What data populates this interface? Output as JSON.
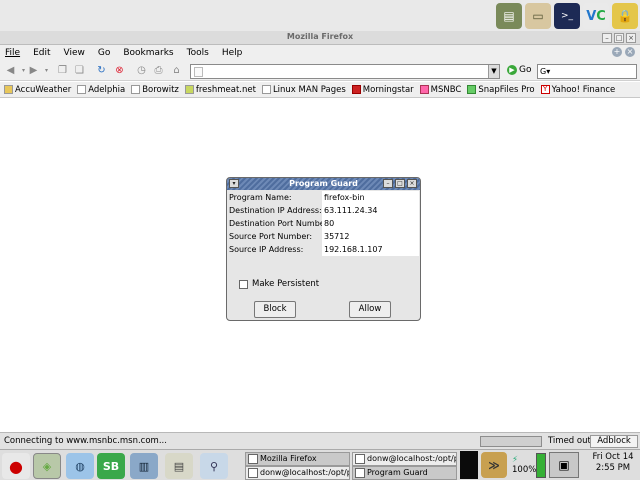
{
  "browser": {
    "window_title": "Mozilla Firefox",
    "menu": [
      "File",
      "Edit",
      "View",
      "Go",
      "Bookmarks",
      "Tools",
      "Help"
    ],
    "url_value": "",
    "go_label": "Go",
    "search_value": "",
    "bookmarks": [
      "AccuWeather",
      "Adelphia",
      "Borowitz",
      "freshmeat.net",
      "Linux MAN Pages",
      "Morningstar",
      "MSNBC",
      "SnapFiles Pro",
      "Yahoo! Finance"
    ],
    "status_text": "Connecting to www.msnbc.msn.com...",
    "timed_out_label": "Timed out",
    "adblock_label": "Adblock"
  },
  "dialog": {
    "title": "Program Guard",
    "rows": [
      {
        "label": "Program Name:",
        "value": "firefox-bin"
      },
      {
        "label": "Destination IP Address:",
        "value": "63.111.24.34"
      },
      {
        "label": "Destination Port Number:",
        "value": "80"
      },
      {
        "label": "Source Port Number:",
        "value": "35712"
      },
      {
        "label": "Source IP Address:",
        "value": "192.168.1.107"
      }
    ],
    "persistent_label": "Make Persistent",
    "persistent_checked": false,
    "block_label": "Block",
    "allow_label": "Allow"
  },
  "taskbar": {
    "tasks": [
      "Mozilla Firefox",
      "donw@localhost:/opt/pgu",
      "donw@localhost:/opt/pgu",
      "Program Guard"
    ],
    "battery": "100%",
    "clock_date": "Fri Oct 14",
    "clock_time": "2:55 PM"
  },
  "colors": {
    "dialog_title_bg": "#4f6d9e",
    "content_bg": "#ffffff"
  }
}
